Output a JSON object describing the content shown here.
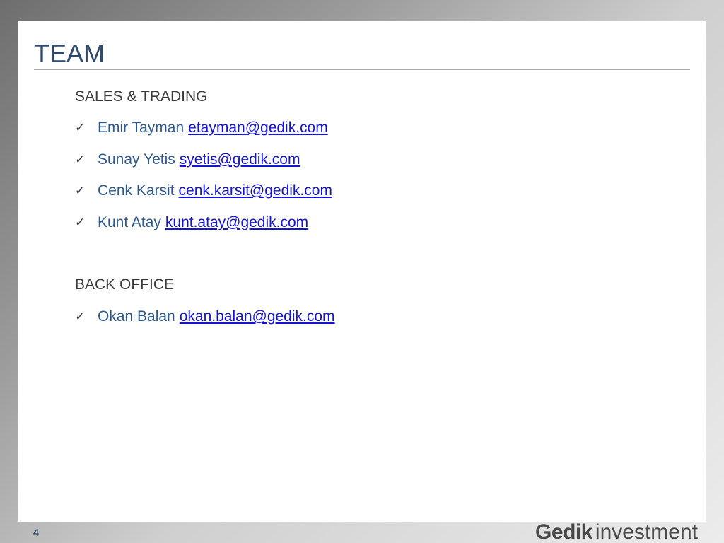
{
  "slide": {
    "title": "TEAM",
    "page_number": "4"
  },
  "sections": [
    {
      "heading": "SALES & TRADING",
      "members": [
        {
          "name": "Emir Tayman",
          "email": "etayman@gedik.com"
        },
        {
          "name": "Sunay Yetis",
          "email": "syetis@gedik.com"
        },
        {
          "name": "Cenk Karsit",
          "email": "cenk.karsit@gedik.com"
        },
        {
          "name": "Kunt Atay",
          "email": "kunt.atay@gedik.com"
        }
      ]
    },
    {
      "heading": "BACK OFFICE",
      "members": [
        {
          "name": "Okan Balan",
          "email": "okan.balan@gedik.com"
        }
      ]
    }
  ],
  "brand": {
    "bold": "Gedik",
    "light": "investment"
  },
  "icons": {
    "bullet": "checkmark-icon"
  },
  "colors": {
    "title": "#2f4a6d",
    "name": "#2f5a8f",
    "link": "#1414d8"
  }
}
